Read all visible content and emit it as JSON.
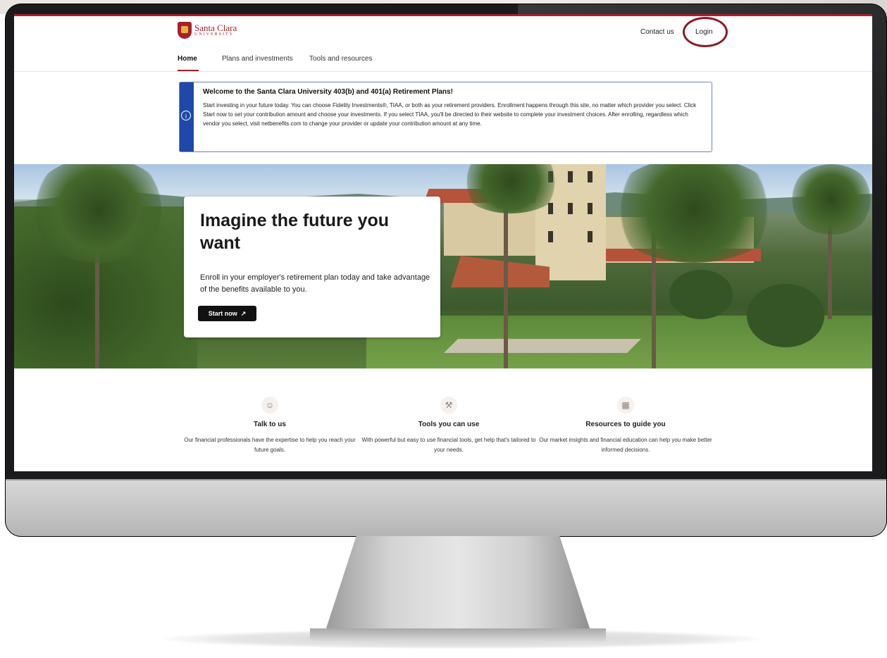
{
  "header": {
    "logo": {
      "name": "Santa Clara",
      "sub": "UNIVERSITY"
    },
    "contact_label": "Contact us",
    "login_label": "Login"
  },
  "nav": {
    "tabs": [
      {
        "label": "Home",
        "active": true
      },
      {
        "label": "Plans and investments",
        "active": false
      },
      {
        "label": "Tools and resources",
        "active": false
      }
    ]
  },
  "notice": {
    "icon": "info-icon",
    "title": "Welcome to the Santa Clara University 403(b) and 401(a) Retirement Plans!",
    "body": "Start investing in your future today. You can choose Fidelity Investments®, TIAA, or both as your retirement providers. Enrollment happens through this site, no matter which provider you select. Click Start now to set your contribution amount and choose your investments. If you select TIAA, you'll be directed to their website to complete your investment choices. After enrolling, regardless which vendor you select, visit netbenefits.com to change your provider or update your contribution amount at any time."
  },
  "hero": {
    "title": "Imagine the future you want",
    "subtitle": "Enroll in your employer's retirement plan today and take advantage of the benefits available to you.",
    "cta_label": "Start now"
  },
  "features": [
    {
      "icon": "chat-person-icon",
      "title": "Talk to us",
      "desc": "Our financial professionals have the expertise to help you reach your future goals."
    },
    {
      "icon": "tools-icon",
      "title": "Tools you can use",
      "desc": "With powerful but easy to use financial tools, get help that's tailored to your needs."
    },
    {
      "icon": "map-icon",
      "title": "Resources to guide you",
      "desc": "Our market insights and financial education can help you make better informed decisions."
    }
  ],
  "colors": {
    "brand": "#a8202c",
    "notice_accent": "#1f48a8",
    "highlight_ring": "#8b1a2a"
  }
}
